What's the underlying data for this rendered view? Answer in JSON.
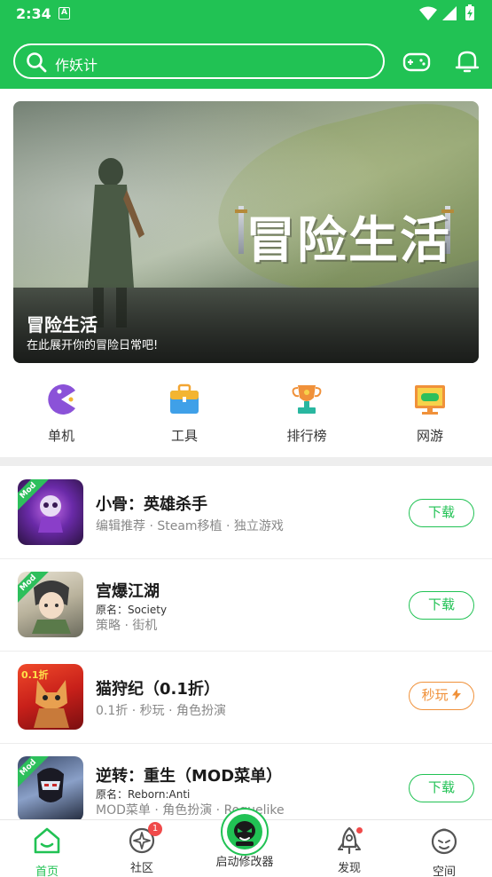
{
  "status_bar": {
    "time": "2:34",
    "notification": "A"
  },
  "search": {
    "placeholder": "作妖计"
  },
  "header_icons": {
    "gamepad": "gamepad-icon",
    "bell": "bell-icon"
  },
  "banner": {
    "big_title": "冒险生活",
    "title": "冒险生活",
    "subtitle": "在此展开你的冒险日常吧!"
  },
  "categories": [
    {
      "label": "单机",
      "icon": "pacman-icon"
    },
    {
      "label": "工具",
      "icon": "toolbox-icon"
    },
    {
      "label": "排行榜",
      "icon": "trophy-icon"
    },
    {
      "label": "网游",
      "icon": "screen-gamepad-icon"
    }
  ],
  "mod_badge": "Mod",
  "games": [
    {
      "title": "小骨：英雄杀手",
      "original": "",
      "tags": "编辑推荐 · Steam移植 · 独立游戏",
      "button": "下载",
      "mod": true
    },
    {
      "title": "宫爆江湖",
      "original": "原名：Society",
      "tags": "策略 · 街机",
      "button": "下载",
      "mod": true
    },
    {
      "title": "猫狩纪（0.1折）",
      "original": "",
      "tags": "0.1折 · 秒玩 · 角色扮演",
      "button": "秒玩",
      "mod": false,
      "thumb_badge": "0.1折"
    },
    {
      "title": "逆转：重生（MOD菜单）",
      "original": "原名：Reborn:Anti",
      "tags": "MOD菜单 · 角色扮演 · Roguelike",
      "button": "下载",
      "mod": true
    }
  ],
  "tabs": [
    {
      "label": "首页",
      "active": true
    },
    {
      "label": "社区",
      "badge": "1"
    },
    {
      "label": "启动修改器"
    },
    {
      "label": "发现"
    },
    {
      "label": "空间"
    }
  ],
  "colors": {
    "brand": "#21c254",
    "orange": "#f0913a",
    "badge": "#f04a4a"
  }
}
